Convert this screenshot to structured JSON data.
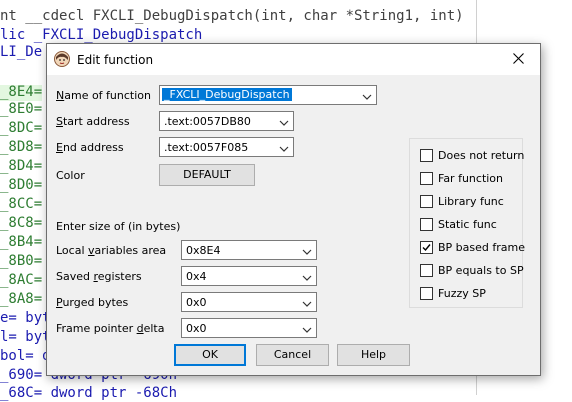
{
  "code": {
    "lines": [
      {
        "text": "nt __cdecl FXCLI_DebugDispatch(int, char *String1, int)"
      },
      {
        "text": "lic _FXCLI_DebugDispatch"
      },
      {
        "text": "LI_De"
      },
      {
        "text": ""
      },
      {
        "text": "_8E4="
      },
      {
        "text": "_8E0="
      },
      {
        "text": "_8DC="
      },
      {
        "text": "_8D8="
      },
      {
        "text": "_8D4="
      },
      {
        "text": "_8D0="
      },
      {
        "text": "_8CC="
      },
      {
        "text": "_8C8="
      },
      {
        "text": "_8B4="
      },
      {
        "text": "_8B0="
      },
      {
        "text": "_8AC="
      },
      {
        "text": "_8A8="
      },
      {
        "text": "e= byt"
      },
      {
        "text": "l= byt"
      },
      {
        "text": "bol= d"
      },
      {
        "text": "_690= dword ptr -690h"
      },
      {
        "text": "_68C= dword ptr -68Ch"
      }
    ]
  },
  "dialog": {
    "title": "Edit function",
    "close_label": "✕",
    "name_label_u": "N",
    "name_label_rest": "ame of function",
    "name_value": "_FXCLI_DebugDispatch",
    "start_label_u": "S",
    "start_label_rest": "tart address",
    "start_value": ".text:0057DB80",
    "end_label_u": "E",
    "end_label_rest": "nd address",
    "end_value": ".text:0057F085",
    "color_label": "Color",
    "color_button": "DEFAULT",
    "size_header": "Enter size of (in bytes)",
    "local_label_pre": "Local ",
    "local_label_u": "v",
    "local_label_rest": "ariables area",
    "local_value": "0x8E4",
    "saved_label_pre": "Saved ",
    "saved_label_u": "r",
    "saved_label_rest": "egisters",
    "saved_value": "0x4",
    "purged_label_u": "P",
    "purged_label_rest": "urged bytes",
    "purged_value": "0x0",
    "fp_label_pre": "Frame pointer ",
    "fp_label_u": "d",
    "fp_label_rest": "elta",
    "fp_value": "0x0",
    "ok": "OK",
    "cancel": "Cancel",
    "help": "Help",
    "checkboxes": [
      {
        "label": "Does not return",
        "checked": false
      },
      {
        "label": "Far function",
        "checked": false
      },
      {
        "label": "Library func",
        "checked": false
      },
      {
        "label": "Static func",
        "checked": false
      },
      {
        "label": "BP based frame",
        "checked": true
      },
      {
        "label": "BP equals to SP",
        "checked": false
      },
      {
        "label": "Fuzzy SP",
        "checked": false
      }
    ]
  }
}
